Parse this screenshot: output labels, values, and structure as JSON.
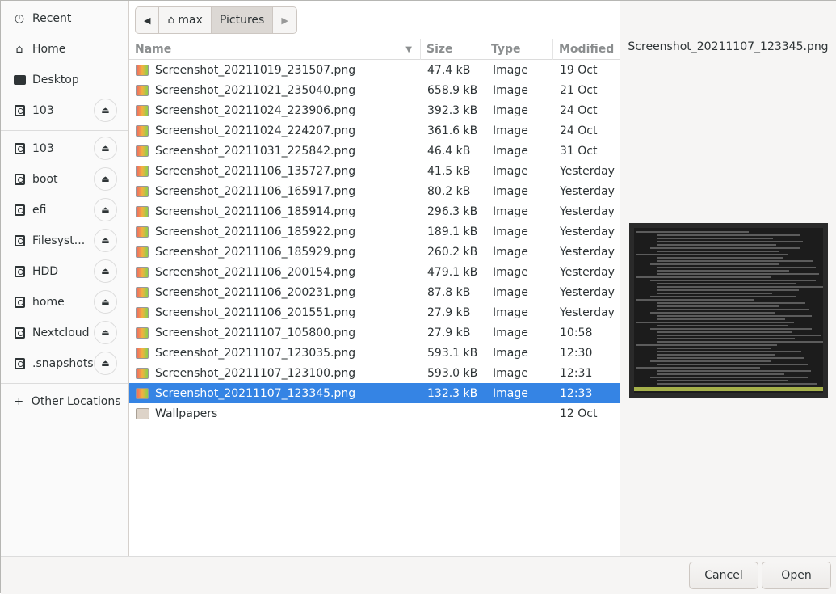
{
  "sidebar": {
    "items": [
      {
        "label": "Recent",
        "icon": "clock-icon"
      },
      {
        "label": "Home",
        "icon": "home-icon"
      },
      {
        "label": "Desktop",
        "icon": "folder-icon"
      },
      {
        "label": "103",
        "icon": "drive-icon",
        "eject": true
      },
      {
        "label": "103",
        "icon": "drive-icon",
        "eject": true
      },
      {
        "label": "boot",
        "icon": "drive-icon",
        "eject": true
      },
      {
        "label": "efi",
        "icon": "drive-icon",
        "eject": true
      },
      {
        "label": "Filesyst...",
        "icon": "drive-icon",
        "eject": true
      },
      {
        "label": "HDD",
        "icon": "drive-icon",
        "eject": true
      },
      {
        "label": "home",
        "icon": "drive-icon",
        "eject": true
      },
      {
        "label": "Nextcloud",
        "icon": "drive-icon",
        "eject": true
      },
      {
        "label": ".snapshots",
        "icon": "drive-icon",
        "eject": true
      },
      {
        "label": "Other Locations",
        "icon": "plus-icon"
      }
    ]
  },
  "pathbar": {
    "home": "max",
    "current": "Pictures"
  },
  "columns": {
    "name": "Name",
    "size": "Size",
    "type": "Type",
    "modified": "Modified"
  },
  "files": [
    {
      "name": "Screenshot_20211019_231507.png",
      "size": "47.4 kB",
      "type": "Image",
      "modified": "19 Oct"
    },
    {
      "name": "Screenshot_20211021_235040.png",
      "size": "658.9 kB",
      "type": "Image",
      "modified": "21 Oct"
    },
    {
      "name": "Screenshot_20211024_223906.png",
      "size": "392.3 kB",
      "type": "Image",
      "modified": "24 Oct"
    },
    {
      "name": "Screenshot_20211024_224207.png",
      "size": "361.6 kB",
      "type": "Image",
      "modified": "24 Oct"
    },
    {
      "name": "Screenshot_20211031_225842.png",
      "size": "46.4 kB",
      "type": "Image",
      "modified": "31 Oct"
    },
    {
      "name": "Screenshot_20211106_135727.png",
      "size": "41.5 kB",
      "type": "Image",
      "modified": "Yesterday"
    },
    {
      "name": "Screenshot_20211106_165917.png",
      "size": "80.2 kB",
      "type": "Image",
      "modified": "Yesterday"
    },
    {
      "name": "Screenshot_20211106_185914.png",
      "size": "296.3 kB",
      "type": "Image",
      "modified": "Yesterday"
    },
    {
      "name": "Screenshot_20211106_185922.png",
      "size": "189.1 kB",
      "type": "Image",
      "modified": "Yesterday"
    },
    {
      "name": "Screenshot_20211106_185929.png",
      "size": "260.2 kB",
      "type": "Image",
      "modified": "Yesterday"
    },
    {
      "name": "Screenshot_20211106_200154.png",
      "size": "479.1 kB",
      "type": "Image",
      "modified": "Yesterday"
    },
    {
      "name": "Screenshot_20211106_200231.png",
      "size": "87.8 kB",
      "type": "Image",
      "modified": "Yesterday"
    },
    {
      "name": "Screenshot_20211106_201551.png",
      "size": "27.9 kB",
      "type": "Image",
      "modified": "Yesterday"
    },
    {
      "name": "Screenshot_20211107_105800.png",
      "size": "27.9 kB",
      "type": "Image",
      "modified": "10:58"
    },
    {
      "name": "Screenshot_20211107_123035.png",
      "size": "593.1 kB",
      "type": "Image",
      "modified": "12:30"
    },
    {
      "name": "Screenshot_20211107_123100.png",
      "size": "593.0 kB",
      "type": "Image",
      "modified": "12:31"
    },
    {
      "name": "Screenshot_20211107_123345.png",
      "size": "132.3 kB",
      "type": "Image",
      "modified": "12:33",
      "selected": true
    },
    {
      "name": "Wallpapers",
      "size": "",
      "type": "",
      "modified": "12 Oct",
      "folder": true
    }
  ],
  "preview": {
    "filename": "Screenshot_20211107_123345.png"
  },
  "buttons": {
    "cancel": "Cancel",
    "open": "Open"
  },
  "colors": {
    "selection": "#3584e4"
  }
}
